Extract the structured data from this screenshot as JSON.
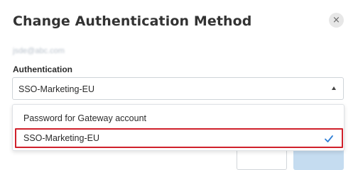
{
  "dialog": {
    "title": "Change Authentication Method",
    "close_icon": "close-icon",
    "close_glyph": "×",
    "email": "jsde@abc.com",
    "authentication_label": "Authentication",
    "select": {
      "value": "SSO-Marketing-EU",
      "caret_icon": "caret-up-icon"
    },
    "options": [
      {
        "label": "Password for Gateway account",
        "selected": false
      },
      {
        "label": "SSO-Marketing-EU",
        "selected": true,
        "icon": "check-icon"
      }
    ]
  },
  "colors": {
    "highlight_border": "#d0202b",
    "check": "#2f7fd6",
    "primary_button": "#c5dcf0"
  }
}
